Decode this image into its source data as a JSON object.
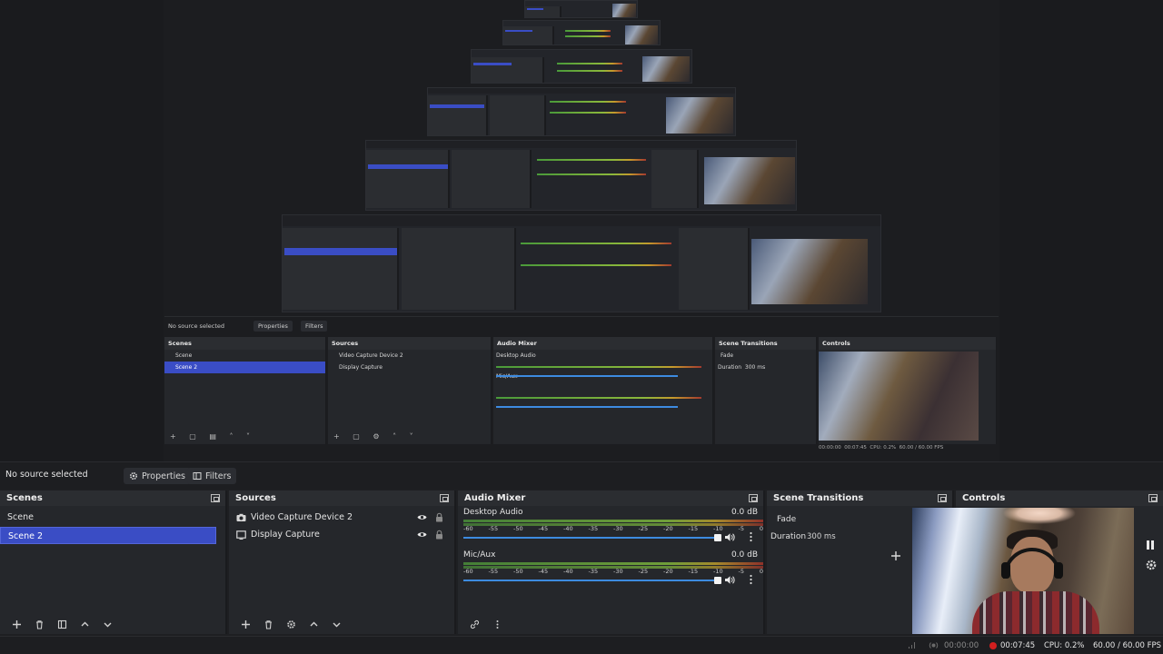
{
  "toolbar": {
    "no_source": "No source selected",
    "properties": "Properties",
    "filters": "Filters"
  },
  "docks": {
    "scenes": {
      "title": "Scenes",
      "items": [
        {
          "label": "Scene",
          "selected": false
        },
        {
          "label": "Scene 2",
          "selected": true
        }
      ]
    },
    "sources": {
      "title": "Sources",
      "items": [
        {
          "label": "Video Capture Device 2",
          "icon": "camera-icon"
        },
        {
          "label": "Display Capture",
          "icon": "monitor-icon"
        }
      ]
    },
    "audio_mixer": {
      "title": "Audio Mixer",
      "channels": [
        {
          "name": "Desktop Audio",
          "db": "0.0 dB",
          "level": 0.85
        },
        {
          "name": "Mic/Aux",
          "db": "0.0 dB",
          "level": 0.85
        }
      ],
      "ticks": [
        "-60",
        "-55",
        "-50",
        "-45",
        "-40",
        "-35",
        "-30",
        "-25",
        "-20",
        "-15",
        "-10",
        "-5",
        "0"
      ]
    },
    "scene_transitions": {
      "title": "Scene Transitions",
      "transition": "Fade",
      "duration_label": "Duration",
      "duration_value": "300 ms"
    },
    "controls": {
      "title": "Controls"
    }
  },
  "status": {
    "live_time": "00:00:00",
    "rec_time": "00:07:45",
    "cpu": "CPU: 0.2%",
    "fps": "60.00 / 60.00 FPS"
  },
  "colors": {
    "selection": "#3a4dc5",
    "dock_bg": "#25272b",
    "rec_red": "#d21f1f",
    "volume_blue": "#3d8be0"
  }
}
